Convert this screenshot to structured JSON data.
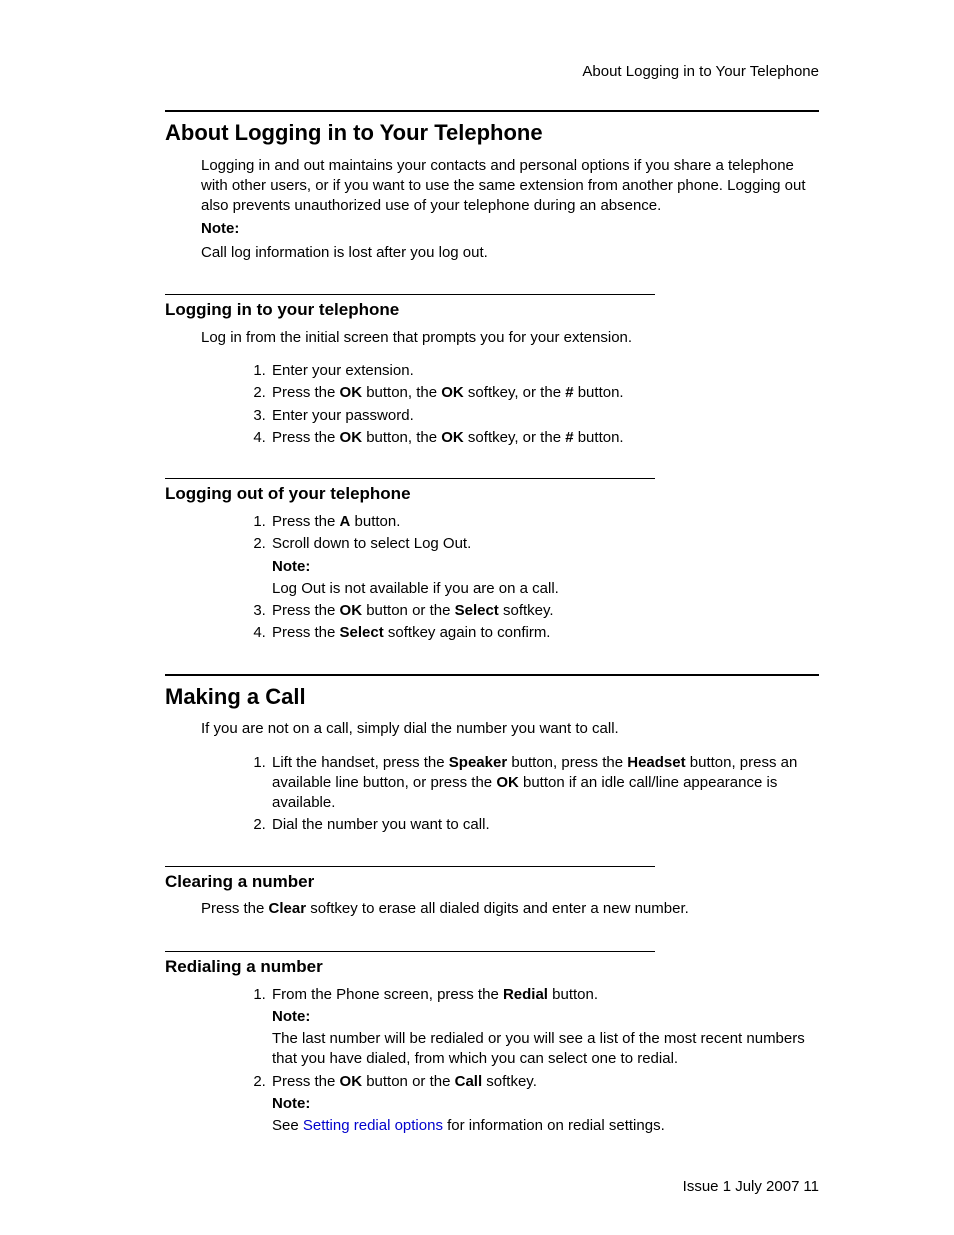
{
  "header": {
    "running_title": "About Logging in to Your Telephone"
  },
  "sections": [
    {
      "id": "s1",
      "level": "h1",
      "title": "About Logging in to Your Telephone",
      "intro": "Logging in and out maintains your contacts and personal options if you share a telephone with other users, or if you want to use the same extension from another phone. Logging out also prevents unauthorized use of your telephone during an absence.",
      "note_label": "Note:",
      "note_body": "Call log information is lost after you log out."
    },
    {
      "id": "s2",
      "level": "h2",
      "title": "Logging in to your telephone",
      "intro": "Log in from the initial screen that prompts you for your extension.",
      "steps": [
        {
          "html": "Enter your extension."
        },
        {
          "html": "Press the <b>OK</b> button, the <b>OK</b> softkey, or the <b>#</b> button."
        },
        {
          "html": "Enter your password."
        },
        {
          "html": "Press the <b>OK</b> button, the <b>OK</b> softkey, or the <b>#</b> button."
        }
      ]
    },
    {
      "id": "s3",
      "level": "h2",
      "title": "Logging out of your telephone",
      "steps": [
        {
          "html": "Press the <b>A</b> button."
        },
        {
          "html": "Scroll down to select Log Out.",
          "note_label": "Note:",
          "note_body": "Log Out is not available if you are on a call."
        },
        {
          "html": "Press the <b>OK</b> button or the <b>Select</b> softkey."
        },
        {
          "html": "Press the <b>Select</b> softkey again to confirm."
        }
      ]
    },
    {
      "id": "s4",
      "level": "h1",
      "title": "Making a Call",
      "intro": "If you are not on a call, simply dial the number you want to call.",
      "steps": [
        {
          "html": "Lift the handset, press the <b>Speaker</b> button, press the <b>Headset</b> button, press an available line button, or press the <b>OK</b> button if an idle call/line appearance is available."
        },
        {
          "html": "Dial the number you want to call."
        }
      ]
    },
    {
      "id": "s5",
      "level": "h2",
      "title": "Clearing a number",
      "intro_html": "Press the <b>Clear</b> softkey to erase all dialed digits and enter a new number."
    },
    {
      "id": "s6",
      "level": "h2",
      "title": "Redialing a number",
      "steps": [
        {
          "html": "From the Phone screen, press the <b>Redial</b> button.",
          "note_label": "Note:",
          "note_body": "The last number will be redialed or you will see a list of the most recent numbers that you have dialed, from which you can select one to redial."
        },
        {
          "html": "Press the <b>OK</b> button or the <b>Call</b> softkey.",
          "note_label": "Note:",
          "note_body_html": "See <span class=\"link\">Setting redial options</span> for information on redial settings."
        }
      ]
    }
  ],
  "footer": {
    "issue": "Issue 1 July 2007",
    "page": "11"
  }
}
